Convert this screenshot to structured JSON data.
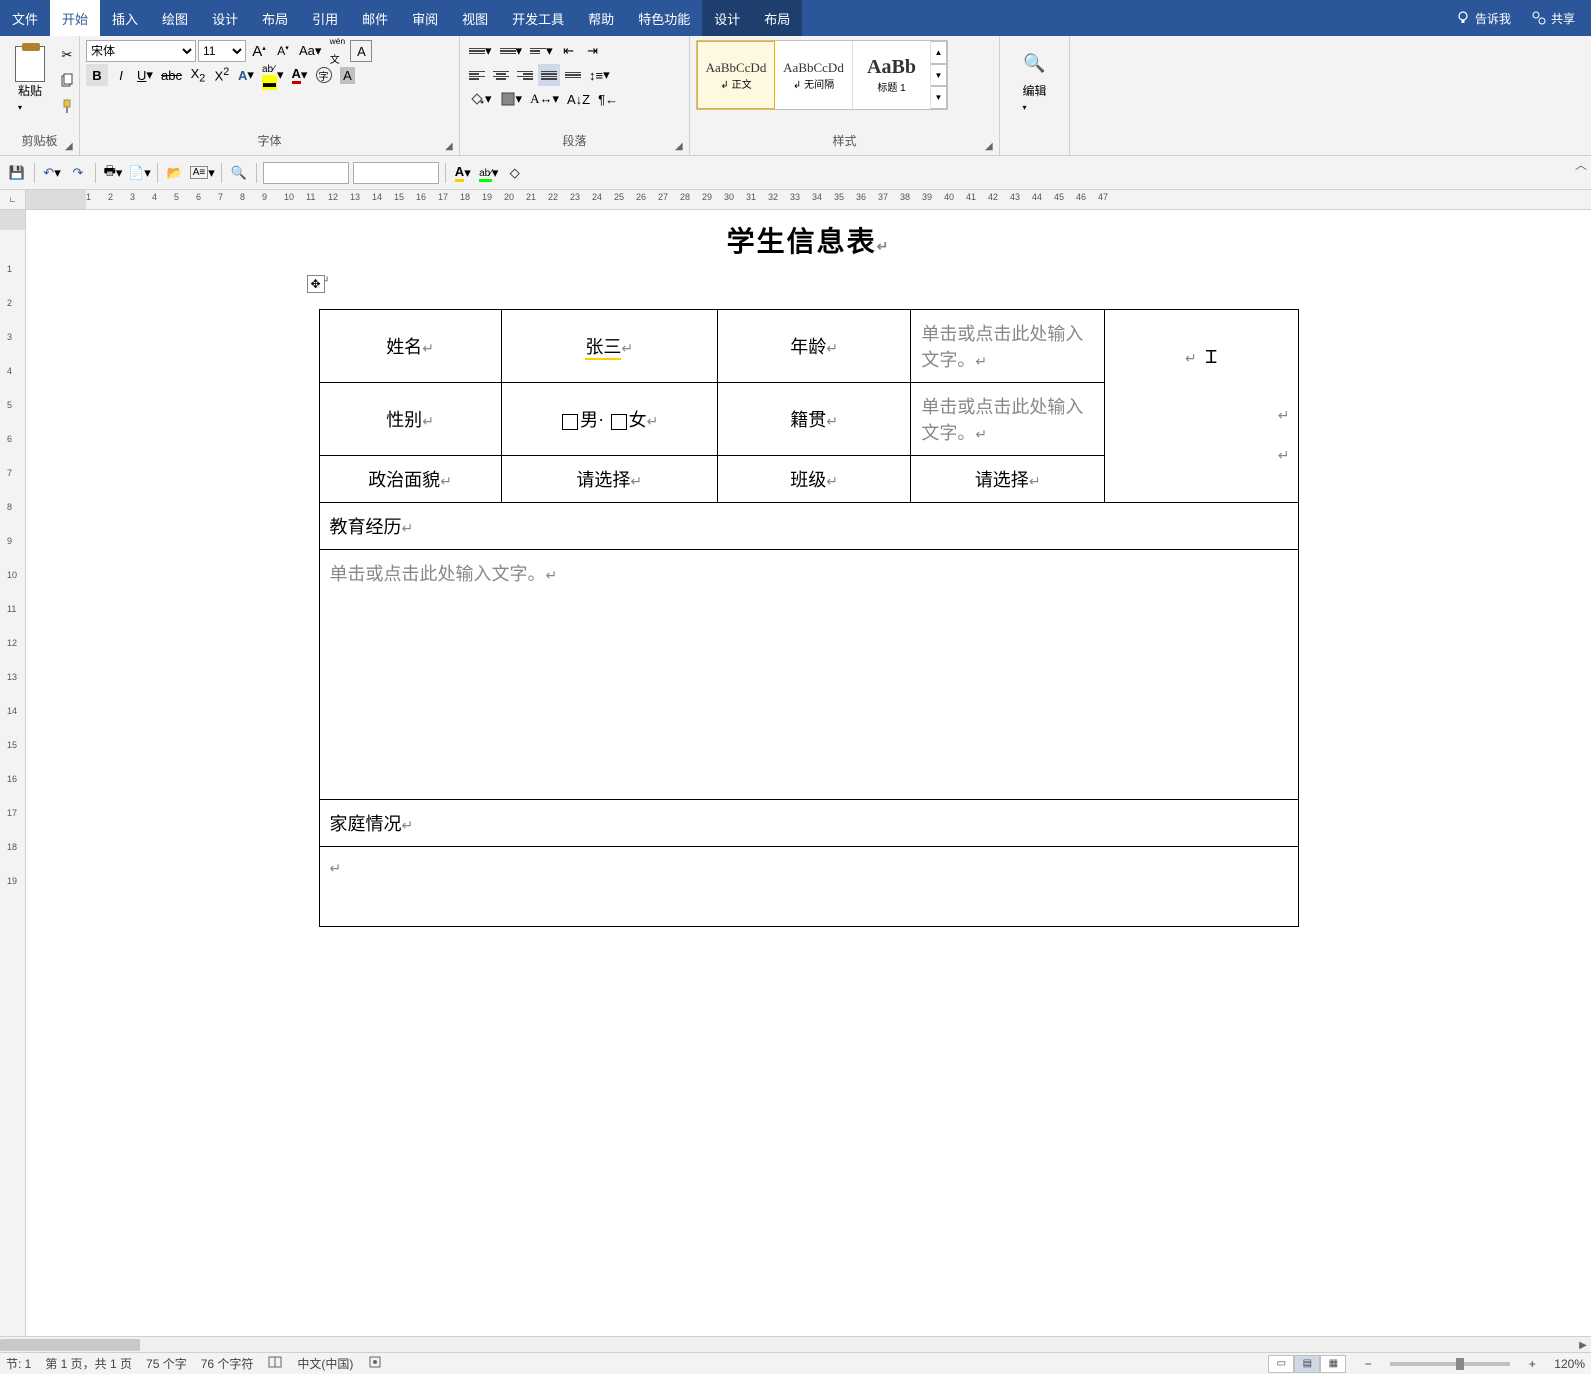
{
  "menu": {
    "file": "文件",
    "home": "开始",
    "insert": "插入",
    "draw": "绘图",
    "design": "设计",
    "layout": "布局",
    "references": "引用",
    "mailings": "邮件",
    "review": "审阅",
    "view": "视图",
    "developer": "开发工具",
    "help": "帮助",
    "special": "特色功能",
    "ctx_design": "设计",
    "ctx_layout": "布局",
    "tell_me": "告诉我",
    "share": "共享"
  },
  "ribbon": {
    "clipboard": {
      "paste": "粘贴",
      "group": "剪贴板"
    },
    "font": {
      "group": "字体",
      "name": "宋体",
      "size": "11",
      "A_box": "A"
    },
    "paragraph": {
      "group": "段落"
    },
    "styles": {
      "group": "样式",
      "sample": "AaBbCcDd",
      "sample_big": "AaBb",
      "normal": "正文",
      "nospacing": "无间隔",
      "heading1": "标题 1"
    },
    "editing": {
      "group": "编辑"
    }
  },
  "doc": {
    "title_partial": "学生信息表",
    "table": {
      "name_label": "姓名",
      "name_value": "张三",
      "age_label": "年龄",
      "placeholder": "单击或点击此处输入文字。",
      "gender_label": "性别",
      "gender_male": "男",
      "gender_female": "女",
      "native_label": "籍贯",
      "politics_label": "政治面貌",
      "select_placeholder": "请选择",
      "class_label": "班级",
      "edu_label": "教育经历",
      "family_label": "家庭情况"
    }
  },
  "status": {
    "section": "节: 1",
    "page": "第 1 页，共 1 页",
    "words": "75 个字",
    "chars": "76 个字符",
    "language": "中文(中国)",
    "zoom": "120%"
  }
}
